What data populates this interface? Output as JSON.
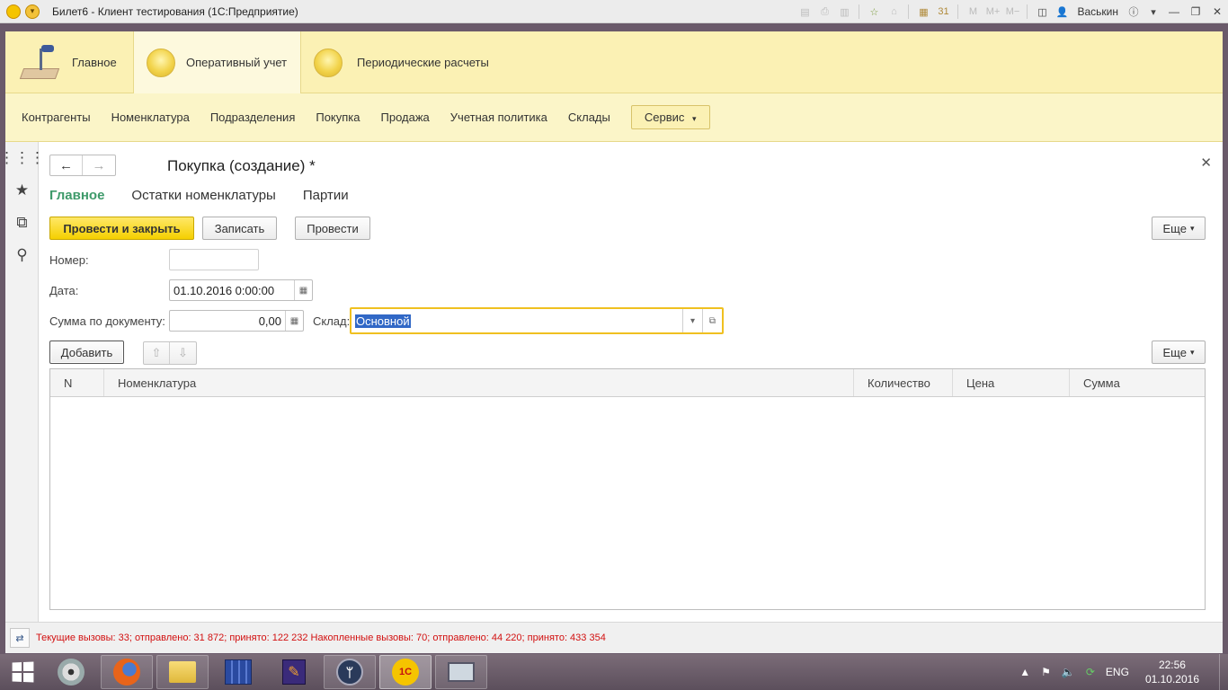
{
  "window": {
    "title": "Билет6 - Клиент тестирования (1С:Предприятие)",
    "user": "Васькин",
    "logo_text": "1С"
  },
  "sections": [
    {
      "label": "Главное",
      "icon": "desk-lamp-icon"
    },
    {
      "label": "Оперативный учет",
      "icon": "section-circle-icon"
    },
    {
      "label": "Периодические расчеты",
      "icon": "section-circle-icon"
    }
  ],
  "commands": {
    "items": [
      "Контрагенты",
      "Номенклатура",
      "Подразделения",
      "Покупка",
      "Продажа",
      "Учетная политика",
      "Склады"
    ],
    "service": "Сервис"
  },
  "form": {
    "title": "Покупка (создание) *",
    "tabs": [
      "Главное",
      "Остатки номенклатуры",
      "Партии"
    ],
    "buttons": {
      "post_close": "Провести и закрыть",
      "save": "Записать",
      "post": "Провести",
      "more": "Еще",
      "add": "Добавить",
      "more2": "Еще"
    },
    "fields": {
      "number_label": "Номер:",
      "number_value": "",
      "date_label": "Дата:",
      "date_value": "01.10.2016  0:00:00",
      "sum_label": "Сумма по документу:",
      "sum_value": "0,00",
      "warehouse_label": "Склад:",
      "warehouse_value": "Основной"
    },
    "table": {
      "columns": [
        "N",
        "Номенклатура",
        "Количество",
        "Цена",
        "Сумма"
      ],
      "rows": []
    }
  },
  "status": {
    "text": "Текущие вызовы: 33; отправлено: 31 872; принято: 122 232   Накопленные вызовы: 70; отправлено: 44 220; принято: 433 354",
    "color": "#d21010"
  },
  "taskbar": {
    "apps": [
      "media-player",
      "firefox",
      "file-explorer",
      "archive-app",
      "editor-app",
      "tree-app",
      "1c-app",
      "remote-desktop"
    ],
    "current_app_label": "1С",
    "language": "ENG",
    "time": "22:56",
    "date": "01.10.2016"
  },
  "colors": {
    "section_panel": "#fbf1b4",
    "accent_tab": "#3e9a6a",
    "primary_button": "#f5d000"
  }
}
